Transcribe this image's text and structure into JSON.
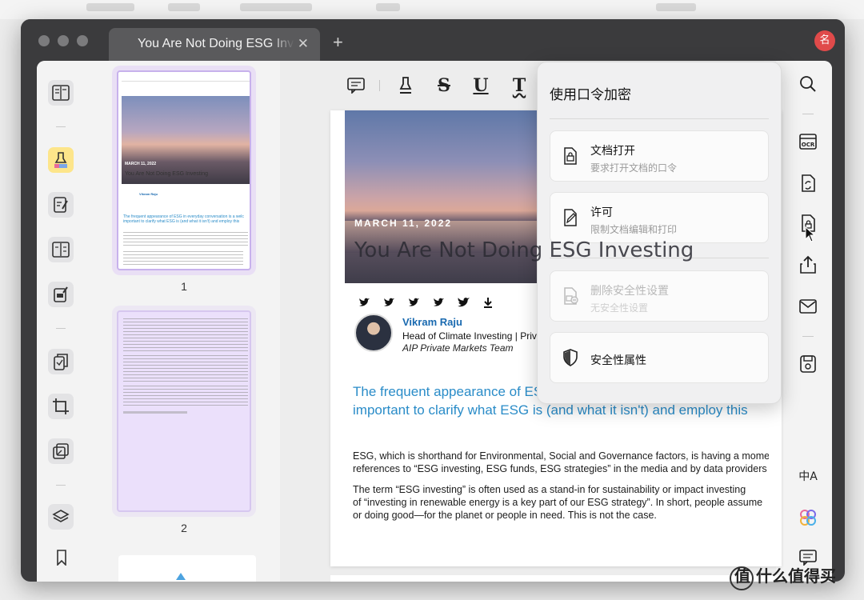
{
  "window": {
    "tab_title": "You Are Not Doing ESG Investing",
    "tab_close": "✕",
    "new_tab": "+",
    "avatar_initial": "名"
  },
  "thumbnails": {
    "pages": [
      {
        "number": "1",
        "selected": true
      },
      {
        "number": "2",
        "selected": false
      }
    ],
    "thumb1": {
      "date": "MARCH 11, 2022",
      "title": "You Are Not Doing ESG Investing",
      "author": "Vikram Raju",
      "blurb": "The frequent appearance of ESG in everyday conversation is a welc important to clarify what ESG is (and what it isn't) and employ this"
    }
  },
  "toolbar": {
    "icons": [
      "comment-icon",
      "highlighter-icon",
      "strikethrough-icon",
      "underline-icon",
      "squiggly-icon",
      "text-icon"
    ],
    "labels": {
      "strike": "S",
      "underline": "U",
      "squiggly": "T",
      "text": "T"
    }
  },
  "document": {
    "hero_date": "MARCH 11, 2022",
    "hero_title": "You Are Not Doing ESG Investing",
    "author_name": "Vikram Raju",
    "author_role": "Head of Climate Investing | Private Markets",
    "author_team": "AIP Private Markets Team",
    "lede_line1": "The frequent appearance of ESG in everyday conversation is a welcome",
    "lede_line2": "important to clarify what ESG is (and what it isn't) and employ this",
    "para1_line1": "ESG, which is shorthand for Environmental, Social and Governance factors, is having a moment",
    "para1_line2": "references to “ESG investing, ESG funds, ESG strategies” in the media and by data providers",
    "para2_line1": "The term “ESG investing” is often used as a stand-in for sustainability or impact investing",
    "para2_line2": "of “investing in renewable energy is a key part of our ESG strategy”. In short, people assume",
    "para2_line3": "or doing good—for the planet or people in need. This is not the case."
  },
  "security_popup": {
    "title": "使用口令加密",
    "options": [
      {
        "label": "文档打开",
        "sub": "要求打开文档的口令",
        "icon": "lock-document-icon",
        "enabled": true
      },
      {
        "label": "许可",
        "sub": "限制文档编辑和打印",
        "icon": "edit-document-icon",
        "enabled": true
      },
      {
        "label": "删除安全性设置",
        "sub": "无安全性设置",
        "icon": "remove-security-icon",
        "enabled": false
      },
      {
        "label": "安全性属性",
        "sub": "",
        "icon": "shield-icon",
        "enabled": true
      }
    ]
  },
  "right_rail": {
    "ocr_label": "OCR",
    "translate_label": "中A"
  },
  "watermark": "值 什么值得买",
  "colors": {
    "accent_purple": "#c7b1ec",
    "active_tool": "#fde58a",
    "link_blue": "#2a8cc8",
    "avatar_red": "#e04a4a"
  }
}
